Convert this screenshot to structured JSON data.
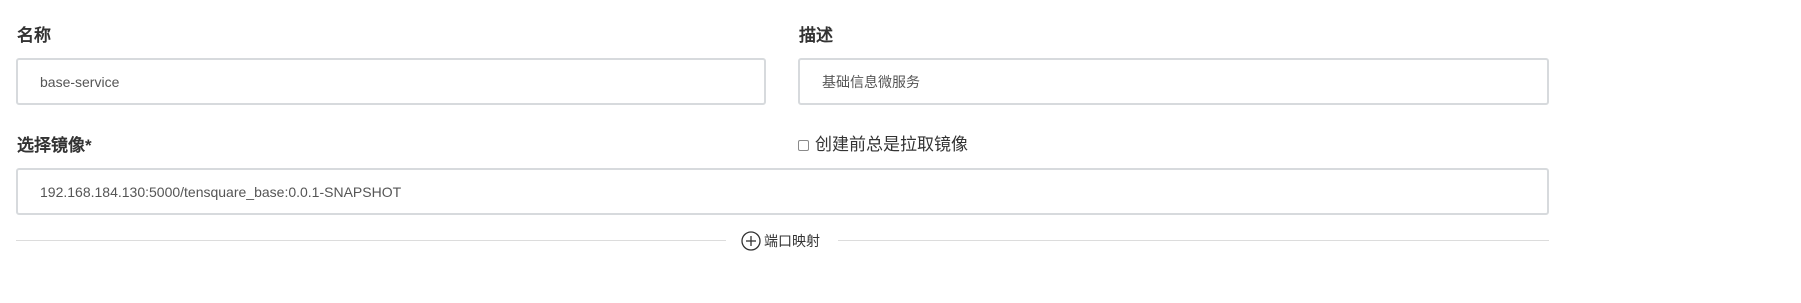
{
  "form": {
    "name_label": "名称",
    "name_value": "base-service",
    "desc_label": "描述",
    "desc_value": "基础信息微服务",
    "image_label": "选择镜像*",
    "image_value": "192.168.184.130:5000/tensquare_base:0.0.1-SNAPSHOT",
    "pull_checkbox_label": "创建前总是拉取镜像",
    "pull_checkbox_checked": false,
    "port_mapping_label": "端口映射",
    "port_mapping_icon": "plus-circle-icon"
  }
}
